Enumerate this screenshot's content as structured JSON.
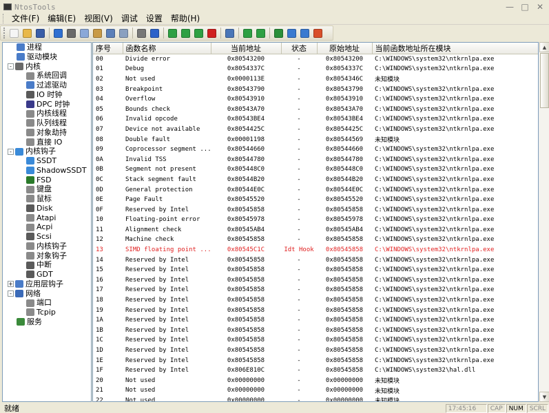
{
  "window": {
    "title": "NtosTools"
  },
  "menu": [
    "文件(F)",
    "编辑(E)",
    "视图(V)",
    "调试",
    "设置",
    "帮助(H)"
  ],
  "toolbar": [
    {
      "icon": "new-icon",
      "color": "#f5f5f5"
    },
    {
      "icon": "open-icon",
      "color": "#e8b84a"
    },
    {
      "icon": "save-icon",
      "color": "#3a5ea8"
    },
    {
      "sep": true
    },
    {
      "icon": "undo-icon",
      "color": "#2f6fd1"
    },
    {
      "icon": "cut-icon",
      "color": "#6a6a6a"
    },
    {
      "icon": "copy-icon",
      "color": "#8aa8d8"
    },
    {
      "icon": "paste-icon",
      "color": "#c89a46"
    },
    {
      "icon": "properties-icon",
      "color": "#5b7fb8"
    },
    {
      "icon": "delete-icon",
      "color": "#8aa0c0"
    },
    {
      "sep": true
    },
    {
      "icon": "print-icon",
      "color": "#777"
    },
    {
      "icon": "help-icon",
      "color": "#2c62c9"
    },
    {
      "sep": true
    },
    {
      "icon": "add-icon",
      "color": "#2ea043"
    },
    {
      "icon": "up-icon",
      "color": "#2ea043"
    },
    {
      "icon": "down-icon",
      "color": "#2ea043"
    },
    {
      "icon": "close-icon",
      "color": "#d02020"
    },
    {
      "sep": true
    },
    {
      "icon": "search-icon",
      "color": "#4a76b8"
    },
    {
      "sep": true
    },
    {
      "icon": "play-icon",
      "color": "#2ea043"
    },
    {
      "icon": "pause-icon",
      "color": "#2ea043"
    },
    {
      "sep": true
    },
    {
      "icon": "monitor-icon",
      "color": "#2a8f3a"
    },
    {
      "icon": "gear-icon",
      "color": "#3a7ad0"
    },
    {
      "icon": "refresh-icon",
      "color": "#3a7ad0"
    },
    {
      "icon": "palette-icon",
      "color": "#d94f2b"
    }
  ],
  "tree": [
    {
      "label": "进程",
      "indent": 1,
      "icon": "process-icon",
      "color": "#4a7cc8"
    },
    {
      "label": "驱动模块",
      "indent": 1,
      "icon": "driver-icon",
      "color": "#4a7cc8"
    },
    {
      "label": "内核",
      "indent": 0,
      "exp": "-",
      "icon": "kernel-icon",
      "color": "#6a6a6a"
    },
    {
      "label": "系统回调",
      "indent": 2,
      "icon": "callback-icon",
      "color": "#8a8a8a"
    },
    {
      "label": "过滤驱动",
      "indent": 2,
      "icon": "filter-icon",
      "color": "#4a7cc8"
    },
    {
      "label": "IO 时钟",
      "indent": 2,
      "icon": "clock-icon",
      "color": "#5a5a5a"
    },
    {
      "label": "DPC 时钟",
      "indent": 2,
      "icon": "clock-icon",
      "color": "#3a3a8a"
    },
    {
      "label": "内核线程",
      "indent": 2,
      "icon": "thread-icon",
      "color": "#8a8a8a"
    },
    {
      "label": "队列线程",
      "indent": 2,
      "icon": "queue-icon",
      "color": "#8a8a8a"
    },
    {
      "label": "对象劫持",
      "indent": 2,
      "icon": "object-icon",
      "color": "#8a8a8a"
    },
    {
      "label": "直接 IO",
      "indent": 2,
      "icon": "io-icon",
      "color": "#8a8a8a"
    },
    {
      "label": "内核钩子",
      "indent": 0,
      "exp": "-",
      "icon": "hook-icon",
      "color": "#3a8ad8"
    },
    {
      "label": "SSDT",
      "indent": 2,
      "icon": "ssdt-icon",
      "color": "#3a8ad8"
    },
    {
      "label": "ShadowSSDT",
      "indent": 2,
      "icon": "shadow-ssdt-icon",
      "color": "#3a8ad8"
    },
    {
      "label": "FSD",
      "indent": 2,
      "icon": "fsd-icon",
      "color": "#2a7a2a"
    },
    {
      "label": "键盘",
      "indent": 2,
      "icon": "keyboard-icon",
      "color": "#8a8a8a"
    },
    {
      "label": "鼠标",
      "indent": 2,
      "icon": "mouse-icon",
      "color": "#8a8a8a"
    },
    {
      "label": "Disk",
      "indent": 2,
      "icon": "disk-icon",
      "color": "#5a5a5a"
    },
    {
      "label": "Atapi",
      "indent": 2,
      "icon": "atapi-icon",
      "color": "#8a8a8a"
    },
    {
      "label": "Acpi",
      "indent": 2,
      "icon": "acpi-icon",
      "color": "#8a8a8a"
    },
    {
      "label": "Scsi",
      "indent": 2,
      "icon": "scsi-icon",
      "color": "#5a5a5a"
    },
    {
      "label": "内核钩子",
      "indent": 2,
      "icon": "kernel-hook-icon",
      "color": "#8a8a8a"
    },
    {
      "label": "对象钩子",
      "indent": 2,
      "icon": "object-hook-icon",
      "color": "#8a8a8a"
    },
    {
      "label": "中断",
      "indent": 2,
      "icon": "interrupt-icon",
      "color": "#5a5a5a"
    },
    {
      "label": "GDT",
      "indent": 2,
      "icon": "gdt-icon",
      "color": "#5a5a5a"
    },
    {
      "label": "应用层钩子",
      "indent": 0,
      "exp": "+",
      "icon": "app-hook-icon",
      "color": "#4a7cc8"
    },
    {
      "label": "网络",
      "indent": 0,
      "exp": "-",
      "icon": "network-icon",
      "color": "#3a6ab8"
    },
    {
      "label": "端口",
      "indent": 2,
      "icon": "port-icon",
      "color": "#8a8a8a"
    },
    {
      "label": "Tcpip",
      "indent": 2,
      "icon": "tcpip-icon",
      "color": "#8a8a8a"
    },
    {
      "label": "服务",
      "indent": 1,
      "icon": "service-icon",
      "color": "#3a8a3a"
    }
  ],
  "table": {
    "columns": [
      "序号",
      "函数名称",
      "当前地址",
      "状态",
      "原始地址",
      "当前函数地址所在模块"
    ],
    "rows": [
      [
        "00",
        "Divide error",
        "0x80543200",
        "-",
        "0x80543200",
        "C:\\WINDOWS\\system32\\ntkrnlpa.exe"
      ],
      [
        "01",
        "Debug",
        "0x8054337C",
        "-",
        "0x8054337C",
        "C:\\WINDOWS\\system32\\ntkrnlpa.exe"
      ],
      [
        "02",
        "Not used",
        "0x0000113E",
        "-",
        "0x8054346C",
        "未知模块"
      ],
      [
        "03",
        "Breakpoint",
        "0x80543790",
        "-",
        "0x80543790",
        "C:\\WINDOWS\\system32\\ntkrnlpa.exe"
      ],
      [
        "04",
        "Overflow",
        "0x80543910",
        "-",
        "0x80543910",
        "C:\\WINDOWS\\system32\\ntkrnlpa.exe"
      ],
      [
        "05",
        "Bounds check",
        "0x80543A70",
        "-",
        "0x80543A70",
        "C:\\WINDOWS\\system32\\ntkrnlpa.exe"
      ],
      [
        "06",
        "Invalid opcode",
        "0x80543BE4",
        "-",
        "0x80543BE4",
        "C:\\WINDOWS\\system32\\ntkrnlpa.exe"
      ],
      [
        "07",
        "Device not available",
        "0x8054425C",
        "-",
        "0x8054425C",
        "C:\\WINDOWS\\system32\\ntkrnlpa.exe"
      ],
      [
        "08",
        "Double fault",
        "0x00001198",
        "-",
        "0x80544569",
        "未知模块"
      ],
      [
        "09",
        "Coprocessor segment ...",
        "0x80544660",
        "-",
        "0x80544660",
        "C:\\WINDOWS\\system32\\ntkrnlpa.exe"
      ],
      [
        "0A",
        "Invalid TSS",
        "0x80544780",
        "-",
        "0x80544780",
        "C:\\WINDOWS\\system32\\ntkrnlpa.exe"
      ],
      [
        "0B",
        "Segment not present",
        "0x805448C0",
        "-",
        "0x805448C0",
        "C:\\WINDOWS\\system32\\ntkrnlpa.exe"
      ],
      [
        "0C",
        "Stack segment fault",
        "0x80544B20",
        "-",
        "0x80544B20",
        "C:\\WINDOWS\\system32\\ntkrnlpa.exe"
      ],
      [
        "0D",
        "General protection",
        "0x80544E0C",
        "-",
        "0x80544E0C",
        "C:\\WINDOWS\\system32\\ntkrnlpa.exe"
      ],
      [
        "0E",
        "Page Fault",
        "0x80545520",
        "-",
        "0x80545520",
        "C:\\WINDOWS\\system32\\ntkrnlpa.exe"
      ],
      [
        "0F",
        "Reserved by Intel",
        "0x80545858",
        "-",
        "0x80545858",
        "C:\\WINDOWS\\system32\\ntkrnlpa.exe"
      ],
      [
        "10",
        "Floating-point error",
        "0x80545978",
        "-",
        "0x80545978",
        "C:\\WINDOWS\\system32\\ntkrnlpa.exe"
      ],
      [
        "11",
        "Alignment check",
        "0x80545AB4",
        "-",
        "0x80545AB4",
        "C:\\WINDOWS\\system32\\ntkrnlpa.exe"
      ],
      [
        "12",
        "Machine check",
        "0x80545858",
        "-",
        "0x80545858",
        "C:\\WINDOWS\\system32\\ntkrnlpa.exe"
      ],
      [
        "13",
        "SIMD floating point ...",
        "0x80545C1C",
        "Idt Hook",
        "0x80545858",
        "C:\\WINDOWS\\system32\\ntkrnlpa.exe"
      ],
      [
        "14",
        "Reserved by Intel",
        "0x80545858",
        "-",
        "0x80545858",
        "C:\\WINDOWS\\system32\\ntkrnlpa.exe"
      ],
      [
        "15",
        "Reserved by Intel",
        "0x80545858",
        "-",
        "0x80545858",
        "C:\\WINDOWS\\system32\\ntkrnlpa.exe"
      ],
      [
        "16",
        "Reserved by Intel",
        "0x80545858",
        "-",
        "0x80545858",
        "C:\\WINDOWS\\system32\\ntkrnlpa.exe"
      ],
      [
        "17",
        "Reserved by Intel",
        "0x80545858",
        "-",
        "0x80545858",
        "C:\\WINDOWS\\system32\\ntkrnlpa.exe"
      ],
      [
        "18",
        "Reserved by Intel",
        "0x80545858",
        "-",
        "0x80545858",
        "C:\\WINDOWS\\system32\\ntkrnlpa.exe"
      ],
      [
        "19",
        "Reserved by Intel",
        "0x80545858",
        "-",
        "0x80545858",
        "C:\\WINDOWS\\system32\\ntkrnlpa.exe"
      ],
      [
        "1A",
        "Reserved by Intel",
        "0x80545858",
        "-",
        "0x80545858",
        "C:\\WINDOWS\\system32\\ntkrnlpa.exe"
      ],
      [
        "1B",
        "Reserved by Intel",
        "0x80545858",
        "-",
        "0x80545858",
        "C:\\WINDOWS\\system32\\ntkrnlpa.exe"
      ],
      [
        "1C",
        "Reserved by Intel",
        "0x80545858",
        "-",
        "0x80545858",
        "C:\\WINDOWS\\system32\\ntkrnlpa.exe"
      ],
      [
        "1D",
        "Reserved by Intel",
        "0x80545858",
        "-",
        "0x80545858",
        "C:\\WINDOWS\\system32\\ntkrnlpa.exe"
      ],
      [
        "1E",
        "Reserved by Intel",
        "0x80545858",
        "-",
        "0x80545858",
        "C:\\WINDOWS\\system32\\ntkrnlpa.exe"
      ],
      [
        "1F",
        "Reserved by Intel",
        "0x806E810C",
        "-",
        "0x80545858",
        "C:\\WINDOWS\\system32\\hal.dll"
      ],
      [
        "20",
        "Not used",
        "0x00000000",
        "-",
        "0x00000000",
        "未知模块"
      ],
      [
        "21",
        "Not used",
        "0x00000000",
        "-",
        "0x00000000",
        "未知模块"
      ],
      [
        "22",
        "Not used",
        "0x00000000",
        "-",
        "0x00000000",
        "未知模块"
      ]
    ],
    "highlight_row": "13",
    "highlight_color": "#e02020"
  },
  "status": {
    "message": "就绪",
    "time": "17:45:16",
    "indicators": [
      {
        "label": "CAP",
        "on": false
      },
      {
        "label": "NUM",
        "on": true
      },
      {
        "label": "SCRL",
        "on": false
      }
    ]
  }
}
